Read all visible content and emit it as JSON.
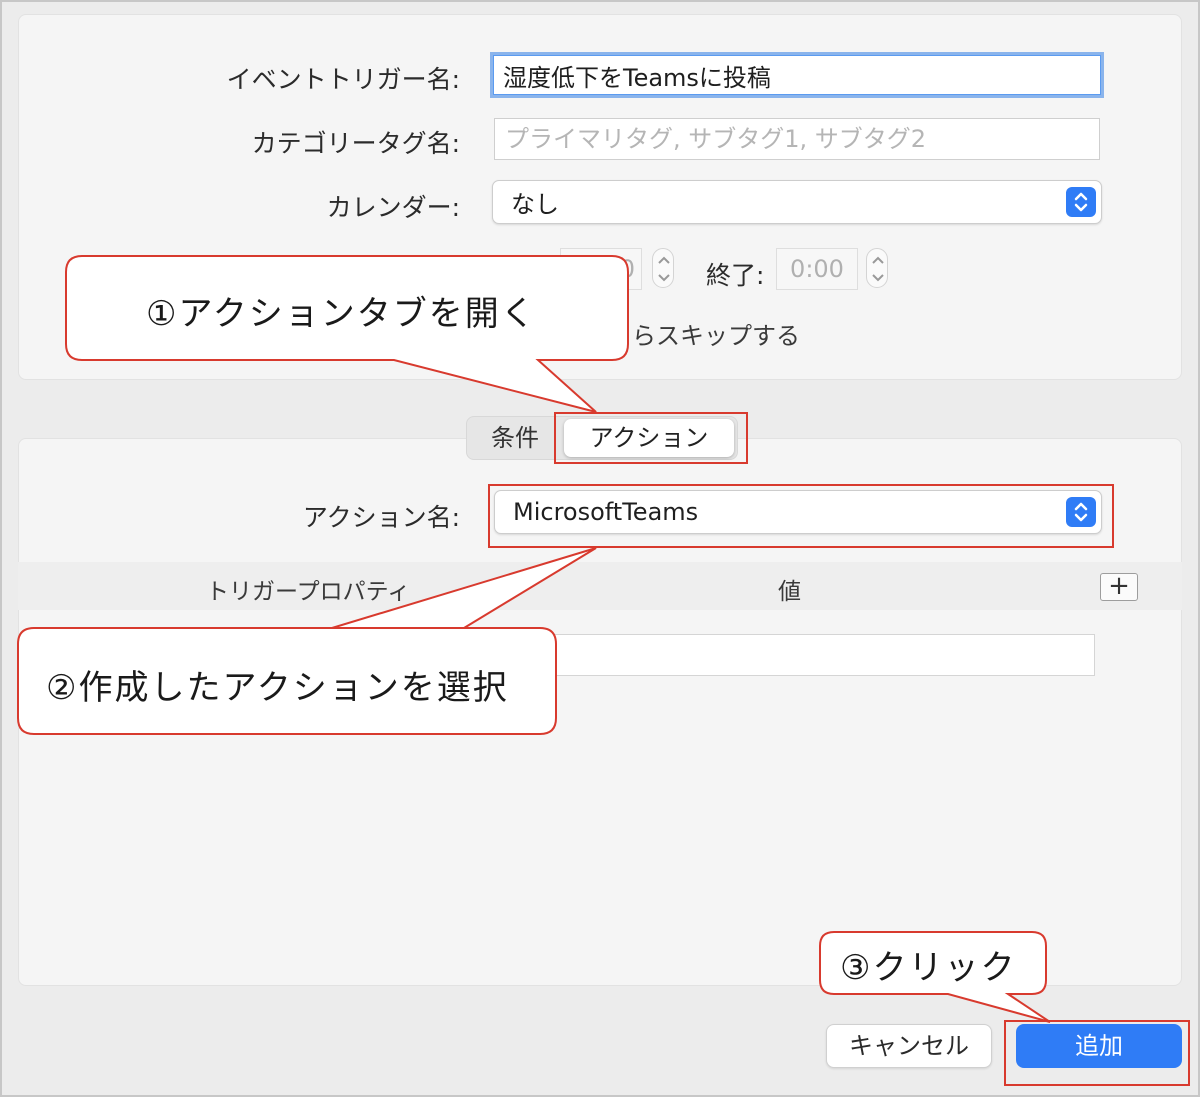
{
  "form": {
    "event_name_label": "イベントトリガー名:",
    "event_name_value": "湿度低下をTeamsに投稿",
    "category_label": "カテゴリータグ名:",
    "category_placeholder": "プライマリタグ, サブタグ1, サブタグ2",
    "calendar_label": "カレンダー:",
    "calendar_value": "なし",
    "start_time_partial": "0",
    "end_label": "終了:",
    "end_time_value": "0:00",
    "skip_partial": "らスキップする"
  },
  "tabs": {
    "condition": "条件",
    "action": "アクション"
  },
  "action": {
    "name_label": "アクション名:",
    "name_value": "MicrosoftTeams",
    "col_property": "トリガープロパティ",
    "col_value": "値",
    "add_row": "+"
  },
  "footer": {
    "cancel": "キャンセル",
    "add": "追加"
  },
  "callouts": {
    "step1": "①アクションタブを開く",
    "step2": "②作成したアクションを選択",
    "step3": "③クリック"
  },
  "colors": {
    "accent": "#2f7cf6",
    "highlight": "#d83a2e"
  }
}
